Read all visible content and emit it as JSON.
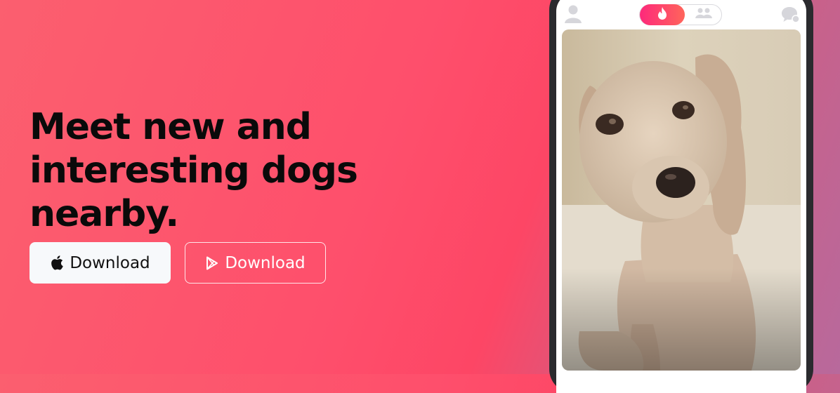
{
  "hero": {
    "title": "Meet new and interesting dogs nearby."
  },
  "buttons": {
    "apple": {
      "label": "Download",
      "icon": "apple-icon"
    },
    "play": {
      "label": "Download",
      "icon": "google-play-icon"
    }
  },
  "phone": {
    "topbar": {
      "left_icon": "profile-icon",
      "toggle_active_icon": "flame-icon",
      "toggle_inactive_icon": "group-icon",
      "right_icon": "chat-icon"
    },
    "card": {
      "image": "dog-photo"
    }
  },
  "colors": {
    "gradient_start": "#fb5f6f",
    "gradient_mid": "#fd4665",
    "gradient_end": "#b8699c",
    "toggle_gradient_start": "#fd297b",
    "toggle_gradient_end": "#ff655b"
  }
}
